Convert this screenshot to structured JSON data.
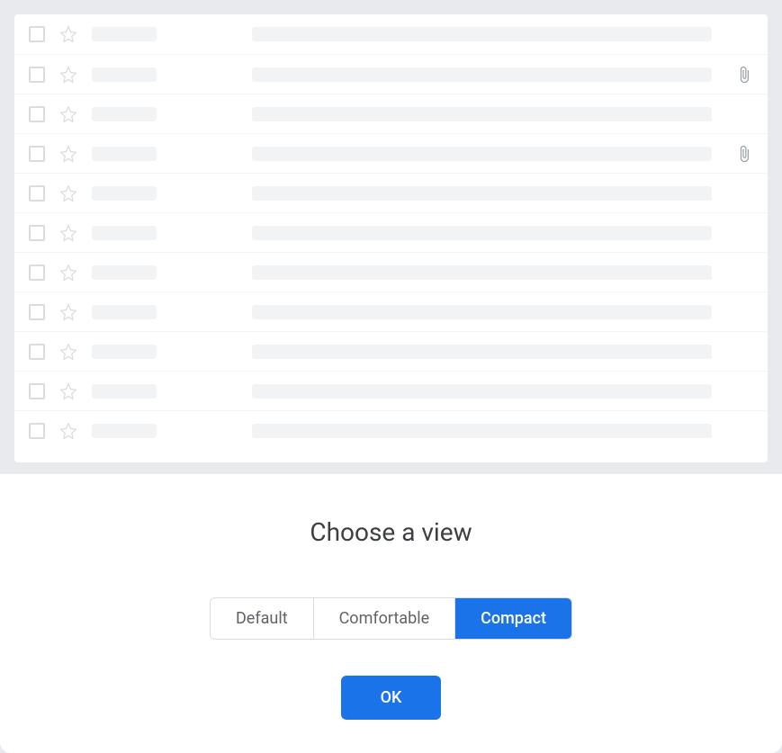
{
  "panel": {
    "title": "Choose a view",
    "options": {
      "default": "Default",
      "comfortable": "Comfortable",
      "compact": "Compact"
    },
    "selected": "compact",
    "confirm_label": "OK"
  },
  "preview": {
    "rows": [
      {
        "has_attachment": false
      },
      {
        "has_attachment": true
      },
      {
        "has_attachment": false
      },
      {
        "has_attachment": true
      },
      {
        "has_attachment": false
      },
      {
        "has_attachment": false
      },
      {
        "has_attachment": false
      },
      {
        "has_attachment": false
      },
      {
        "has_attachment": false
      },
      {
        "has_attachment": false
      },
      {
        "has_attachment": false
      }
    ]
  },
  "colors": {
    "accent": "#1a73e8",
    "border": "#dadce0",
    "placeholder": "#f1f3f4",
    "text_primary": "#3c4043",
    "text_secondary": "#5f6368"
  }
}
